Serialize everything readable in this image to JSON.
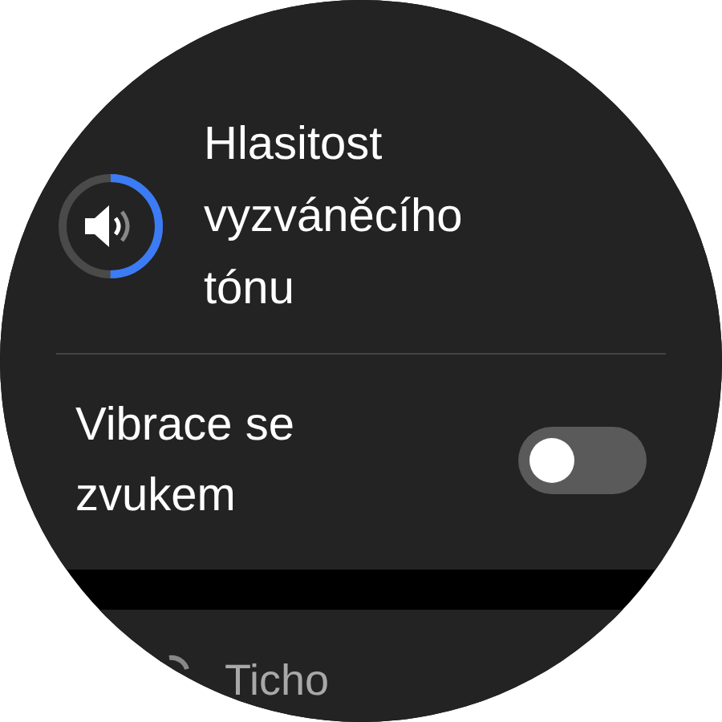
{
  "volume": {
    "title": "Hlasitost vyzváněcího tónu",
    "level": 0.5
  },
  "vibrate": {
    "label": "Vibrace se zvukem",
    "on": false
  },
  "next_item": {
    "label": "Ticho"
  }
}
